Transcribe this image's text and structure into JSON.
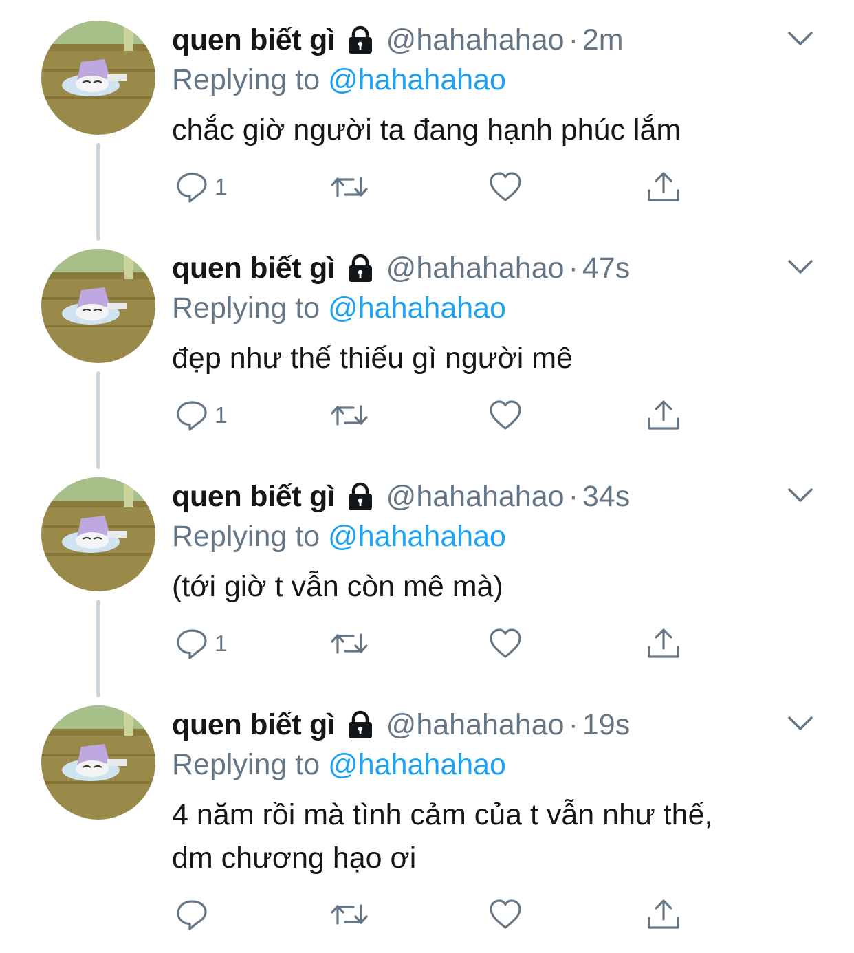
{
  "colors": {
    "text": "#14171a",
    "secondary": "#657786",
    "link": "#1da1f2",
    "thread_line": "#cdd6dd"
  },
  "tweets": [
    {
      "display_name": "quen biết gì",
      "handle": "@hahahahao",
      "separator": "·",
      "time": "2m",
      "replying_prefix": "Replying to",
      "replying_handle": "@hahahahao",
      "text_lines": [
        "chắc giờ người ta đang hạnh phúc lắm"
      ],
      "reply_count": "1"
    },
    {
      "display_name": "quen biết gì",
      "handle": "@hahahahao",
      "separator": "·",
      "time": "47s",
      "replying_prefix": "Replying to",
      "replying_handle": "@hahahahao",
      "text_lines": [
        "đẹp như thế thiếu gì người mê"
      ],
      "reply_count": "1"
    },
    {
      "display_name": "quen biết gì",
      "handle": "@hahahahao",
      "separator": "·",
      "time": "34s",
      "replying_prefix": "Replying to",
      "replying_handle": "@hahahahao",
      "text_lines": [
        "(tới giờ t vẫn còn mê mà)"
      ],
      "reply_count": "1"
    },
    {
      "display_name": "quen biết gì",
      "handle": "@hahahahao",
      "separator": "·",
      "time": "19s",
      "replying_prefix": "Replying to",
      "replying_handle": "@hahahahao",
      "text_lines": [
        "4 năm rồi mà tình cảm của t vẫn như thế,",
        "dm chương hạo ơi"
      ],
      "reply_count": ""
    }
  ]
}
